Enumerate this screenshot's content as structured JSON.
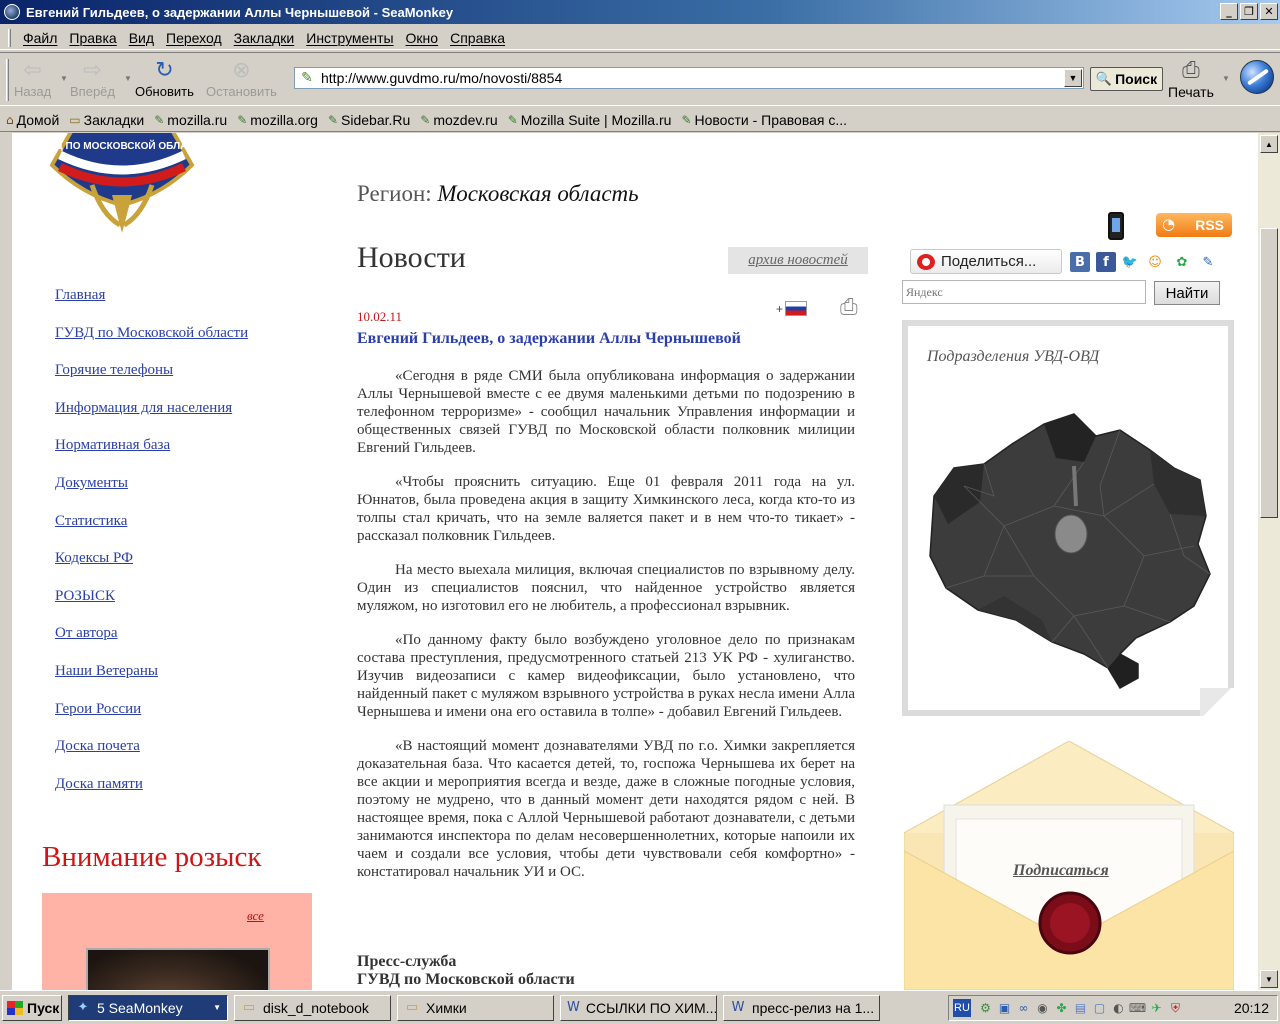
{
  "window": {
    "title": "Евгений Гильдеев, о задержании Аллы Чернышевой - SeaMonkey",
    "minimize": "_",
    "maximize": "❐",
    "close": "✕"
  },
  "menu": [
    "Файл",
    "Правка",
    "Вид",
    "Переход",
    "Закладки",
    "Инструменты",
    "Окно",
    "Справка"
  ],
  "toolbar": {
    "back": "Назад",
    "forward": "Вперёд",
    "reload": "Обновить",
    "stop": "Остановить",
    "url": "http://www.guvdmo.ru/mo/novosti/8854",
    "search": "Поиск",
    "print": "Печать"
  },
  "bookmarks": [
    {
      "label": "Домой",
      "icon": "home-icon"
    },
    {
      "label": "Закладки",
      "icon": "folder-icon"
    },
    {
      "label": "mozilla.ru",
      "icon": "bookmark-icon"
    },
    {
      "label": "mozilla.org",
      "icon": "bookmark-icon"
    },
    {
      "label": "Sidebar.Ru",
      "icon": "bookmark-icon"
    },
    {
      "label": "mozdev.ru",
      "icon": "bookmark-icon"
    },
    {
      "label": "Mozilla Suite | Mozilla.ru",
      "icon": "bookmark-icon"
    },
    {
      "label": "Новости - Правовая с...",
      "icon": "bookmark-icon"
    }
  ],
  "page": {
    "logo_text": "ГУВД ПО МОСКОВСКОЙ ОБЛАСТИ",
    "region_label": "Регион:",
    "region_value": "Московская область",
    "news_heading": "Новости",
    "archive_link": "архив новостей",
    "nav": [
      "Главная",
      "ГУВД по Московской области",
      "Горячие телефоны",
      "Информация для населения",
      "Нормативная база",
      "Документы",
      "Статистика",
      "Кодексы РФ",
      "РОЗЫСК",
      "От автора",
      "Наши Ветераны",
      "Герои России",
      "Доска почета",
      "Доска памяти"
    ],
    "wanted_title": "Внимание розыск",
    "wanted_all": "все",
    "article": {
      "date": "10.02.11",
      "flag_prefix": "+",
      "title": "Евгений Гильдеев, о задержании Аллы Чернышевой",
      "paragraphs": [
        "«Сегодня в ряде СМИ была опубликована информация о задержании Аллы Чернышевой вместе с ее двумя маленькими детьми по подозрению в телефонном терроризме» - сообщил начальник Управления информации и общественных связей ГУВД по Московской области полковник милиции Евгений Гильдеев.",
        "«Чтобы прояснить ситуацию. Еще 01 февраля 2011 года на ул. Юннатов, была проведена акция в защиту Химкинского леса, когда кто-то из толпы стал кричать, что на земле валяется пакет и в нем что-то тикает» - рассказал полковник Гильдеев.",
        "На место выехала милиция, включая специалистов по взрывному делу. Один из специалистов пояснил, что найденное устройство является муляжом, но изготовил его не любитель, а профессионал взрывник.",
        "«По данному факту было возбуждено уголовное дело по признакам состава преступления, предусмотренного статьей 213 УК РФ - хулиганство. Изучив видеозаписи с камер видеофиксации, было установлено, что найденный пакет с муляжом взрывного устройства в руках несла имени Алла Чернышева и имени она его оставила в толпе» - добавил Евгений Гильдеев.",
        "«В настоящий момент дознавателями УВД по г.о. Химки закрепляется доказательная база. Что касается детей, то, госпожа Чернышева их берет на все акции и мероприятия всегда и везде, даже в сложные погодные условия, поэтому не мудрено, что в данный момент дети находятся рядом с ней. В настоящее время, пока с Аллой Чернышевой работают дознаватели, с детьми занимаются инспектора по делам несовершеннолетних, которые напоили их чаем и создали все условия, чтобы дети чувствовали себя комфортно» - констатировал начальник УИ и ОС."
      ],
      "signature_1": "Пресс-служба",
      "signature_2": "ГУВД по Московской области"
    },
    "rss": "RSS",
    "share": "Поделиться...",
    "social": [
      {
        "icon": "vkontakte-icon",
        "glyph": "В",
        "color": "#4a6ea9"
      },
      {
        "icon": "facebook-icon",
        "glyph": "f",
        "color": "#3b5998"
      },
      {
        "icon": "twitter-icon",
        "glyph": "🐦",
        "color": "#ffffff"
      },
      {
        "icon": "odnoklassniki-icon",
        "glyph": "☺",
        "color": "#ffffff"
      },
      {
        "icon": "moimir-icon",
        "glyph": "✿",
        "color": "#ffffff"
      },
      {
        "icon": "livejournal-icon",
        "glyph": "✎",
        "color": "#ffffff"
      }
    ],
    "search_placeholder": "Яндекс",
    "search_button": "Найти",
    "map_title": "Подразделения УВД-ОВД",
    "subscribe": "Подписаться"
  },
  "taskbar": {
    "start": "Пуск",
    "tasks": [
      {
        "label": "5 SeaMonkey",
        "icon": "seamonkey-icon",
        "active": true
      },
      {
        "label": "disk_d_notebook",
        "icon": "folder-icon"
      },
      {
        "label": "Химки",
        "icon": "folder-icon"
      },
      {
        "label": "ССЫЛКИ ПО ХИМ...",
        "icon": "word-icon"
      },
      {
        "label": "пресс-релиз на 1...",
        "icon": "word-icon"
      }
    ],
    "lang": "RU",
    "clock": "20:12"
  }
}
